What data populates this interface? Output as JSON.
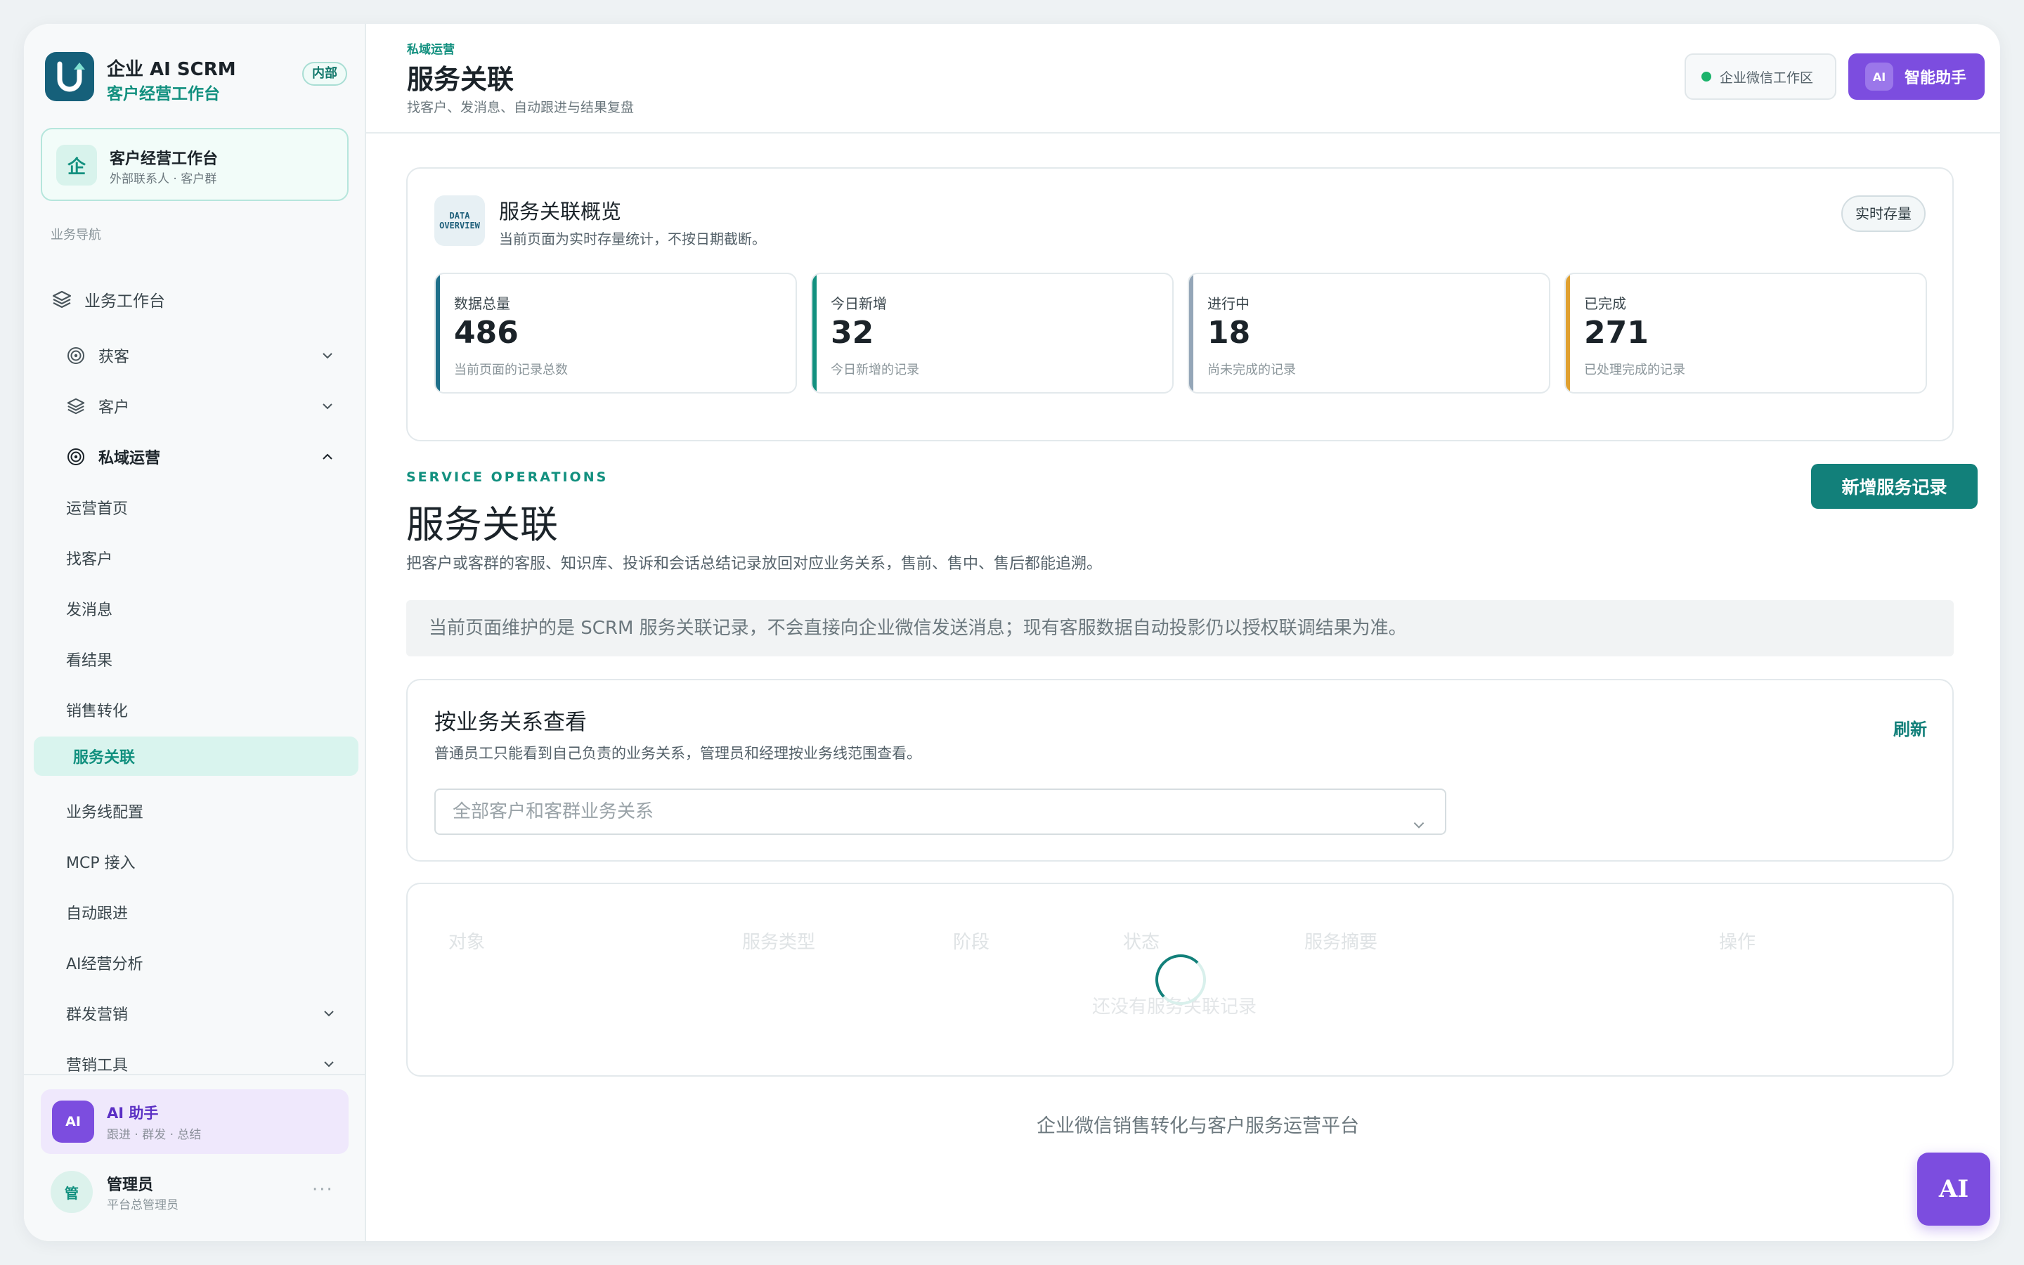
{
  "brand": {
    "title": "企业 AI SCRM",
    "subtitle": "客户经营工作台",
    "badge": "内部"
  },
  "workspace": {
    "icon_char": "企",
    "title": "客户经营工作台",
    "subtitle": "外部联系人 · 客户群"
  },
  "sidebar": {
    "section_label": "业务导航",
    "items": [
      {
        "label": "业务工作台",
        "icon": "layers-icon"
      },
      {
        "label": "获客",
        "icon": "target-icon"
      },
      {
        "label": "客户",
        "icon": "layers-icon"
      },
      {
        "label": "私域运营",
        "icon": "target-icon"
      },
      {
        "label": "运营首页"
      },
      {
        "label": "找客户"
      },
      {
        "label": "发消息"
      },
      {
        "label": "看结果"
      },
      {
        "label": "销售转化"
      },
      {
        "label": "服务关联"
      },
      {
        "label": "业务线配置"
      },
      {
        "label": "MCP 接入"
      },
      {
        "label": "自动跟进"
      },
      {
        "label": "AI经营分析"
      },
      {
        "label": "群发营销"
      },
      {
        "label": "营销工具"
      }
    ],
    "active_item": "服务关联"
  },
  "ai_assistant": {
    "badge": "AI",
    "title": "AI 助手",
    "subtitle": "跟进 · 群发 · 总结"
  },
  "user": {
    "avatar_char": "管",
    "name": "管理员",
    "role": "平台总管理员",
    "more": "···"
  },
  "header": {
    "breadcrumb": "私域运营",
    "title": "服务关联",
    "subtitle": "找客户、发消息、自动跟进与结果复盘",
    "workspace_pill": "企业微信工作区",
    "assistant_badge": "AI",
    "assistant_label": "智能助手",
    "status_color": "#1bb36b"
  },
  "overview": {
    "icon_line1": "DATA",
    "icon_line2": "OVERVIEW",
    "title": "服务关联概览",
    "subtitle": "当前页面为实时存量统计，不按日期截断。",
    "tag": "实时存量",
    "stats": [
      {
        "label": "数据总量",
        "value": "486",
        "note": "当前页面的记录总数",
        "color": "#1e6f8a"
      },
      {
        "label": "今日新增",
        "value": "32",
        "note": "今日新增的记录",
        "color": "#12907f"
      },
      {
        "label": "进行中",
        "value": "18",
        "note": "尚未完成的记录",
        "color": "#94a6b8"
      },
      {
        "label": "已完成",
        "value": "271",
        "note": "已处理完成的记录",
        "color": "#e0a030"
      }
    ]
  },
  "section": {
    "eyebrow": "SERVICE OPERATIONS",
    "title": "服务关联",
    "description": "把客户或客群的客服、知识库、投诉和会话总结记录放回对应业务关系，售前、售中、售后都能追溯。",
    "add_button": "新增服务记录",
    "notice": "当前页面维护的是 SCRM 服务关联记录，不会直接向企业微信发送消息；现有客服数据自动投影仍以授权联调结果为准。"
  },
  "filter": {
    "title": "按业务关系查看",
    "subtitle": "普通员工只能看到自己负责的业务关系，管理员和经理按业务线范围查看。",
    "refresh": "刷新",
    "select_value": "全部客户和客群业务关系"
  },
  "table": {
    "columns": [
      "对象",
      "服务类型",
      "阶段",
      "状态",
      "服务摘要",
      "操作"
    ],
    "empty_text": "还没有服务关联记录"
  },
  "footer": {
    "text": "企业微信销售转化与客户服务运营平台"
  },
  "float_button": {
    "label": "AI"
  },
  "colors": {
    "accent": "#12907f",
    "brand": "#16607a",
    "purple": "#7c4ddf"
  }
}
